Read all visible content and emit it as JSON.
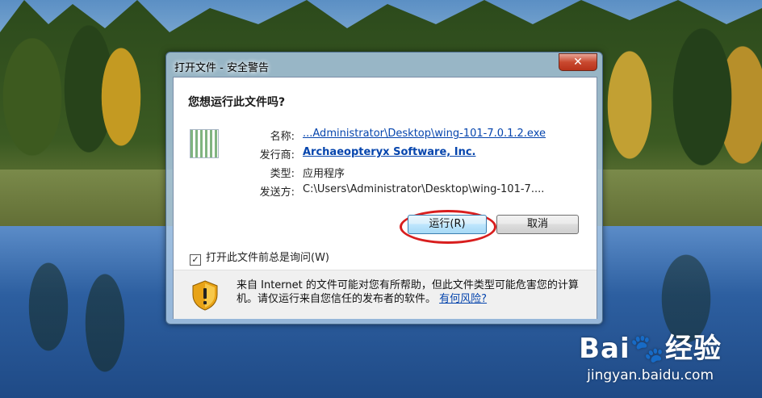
{
  "dialog": {
    "title": "打开文件 - 安全警告",
    "close_label": "✕",
    "heading": "您想运行此文件吗?",
    "fields": [
      {
        "label": "名称:",
        "value": "...Administrator\\Desktop\\wing-101-7.0.1.2.exe"
      },
      {
        "label": "发行商:",
        "value": "Archaeopteryx Software, Inc."
      },
      {
        "label": "类型:",
        "value": "应用程序"
      },
      {
        "label": "发送方:",
        "value": "C:\\Users\\Administrator\\Desktop\\wing-101-7...."
      }
    ],
    "run_button": "运行(R)",
    "cancel_button": "取消",
    "checkbox_label": "打开此文件前总是询问(W)",
    "checkbox_checked": true,
    "checkbox_mark": "✓",
    "warning_text": "来自 Internet 的文件可能对您有所帮助，但此文件类型可能危害您的计算机。请仅运行来自您信任的发布者的软件。",
    "risk_link": "有何风险?"
  },
  "watermark": {
    "logo": "Bai🐾经验",
    "url": "jingyan.baidu.com"
  },
  "colors": {
    "link": "#0645ad",
    "highlight_ring": "#d81e1e",
    "shield": "#e8a317"
  }
}
